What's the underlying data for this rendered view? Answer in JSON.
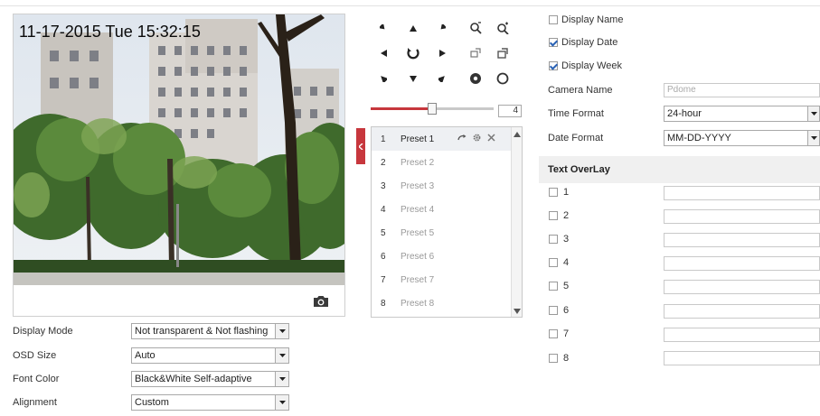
{
  "video": {
    "osd_text": "11-17-2015 Tue 15:32:15",
    "snapshot_icon": "camera-icon"
  },
  "osd_form": {
    "display_mode": {
      "label": "Display Mode",
      "value": "Not transparent & Not flashing"
    },
    "osd_size": {
      "label": "OSD Size",
      "value": "Auto"
    },
    "font_color": {
      "label": "Font Color",
      "value": "Black&White Self-adaptive"
    },
    "alignment": {
      "label": "Alignment",
      "value": "Custom"
    }
  },
  "ptz": {
    "speed": "4",
    "speed_fraction": 0.5,
    "accent_color": "#c7373d",
    "presets": [
      {
        "num": "1",
        "name": "Preset 1"
      },
      {
        "num": "2",
        "name": "Preset 2"
      },
      {
        "num": "3",
        "name": "Preset 3"
      },
      {
        "num": "4",
        "name": "Preset 4"
      },
      {
        "num": "5",
        "name": "Preset 5"
      },
      {
        "num": "6",
        "name": "Preset 6"
      },
      {
        "num": "7",
        "name": "Preset 7"
      },
      {
        "num": "8",
        "name": "Preset 8"
      }
    ]
  },
  "display": {
    "display_name": {
      "label": "Display Name",
      "checked": false
    },
    "display_date": {
      "label": "Display Date",
      "checked": true
    },
    "display_week": {
      "label": "Display Week",
      "checked": true
    },
    "camera_name": {
      "label": "Camera Name",
      "placeholder": "Pdome"
    },
    "time_format": {
      "label": "Time Format",
      "value": "24-hour"
    },
    "date_format": {
      "label": "Date Format",
      "value": "MM-DD-YYYY"
    }
  },
  "text_overlay": {
    "title": "Text OverLay",
    "items": [
      {
        "num": "1",
        "checked": false
      },
      {
        "num": "2",
        "checked": false
      },
      {
        "num": "3",
        "checked": false
      },
      {
        "num": "4",
        "checked": false
      },
      {
        "num": "5",
        "checked": false
      },
      {
        "num": "6",
        "checked": false
      },
      {
        "num": "7",
        "checked": false
      },
      {
        "num": "8",
        "checked": false
      }
    ]
  }
}
